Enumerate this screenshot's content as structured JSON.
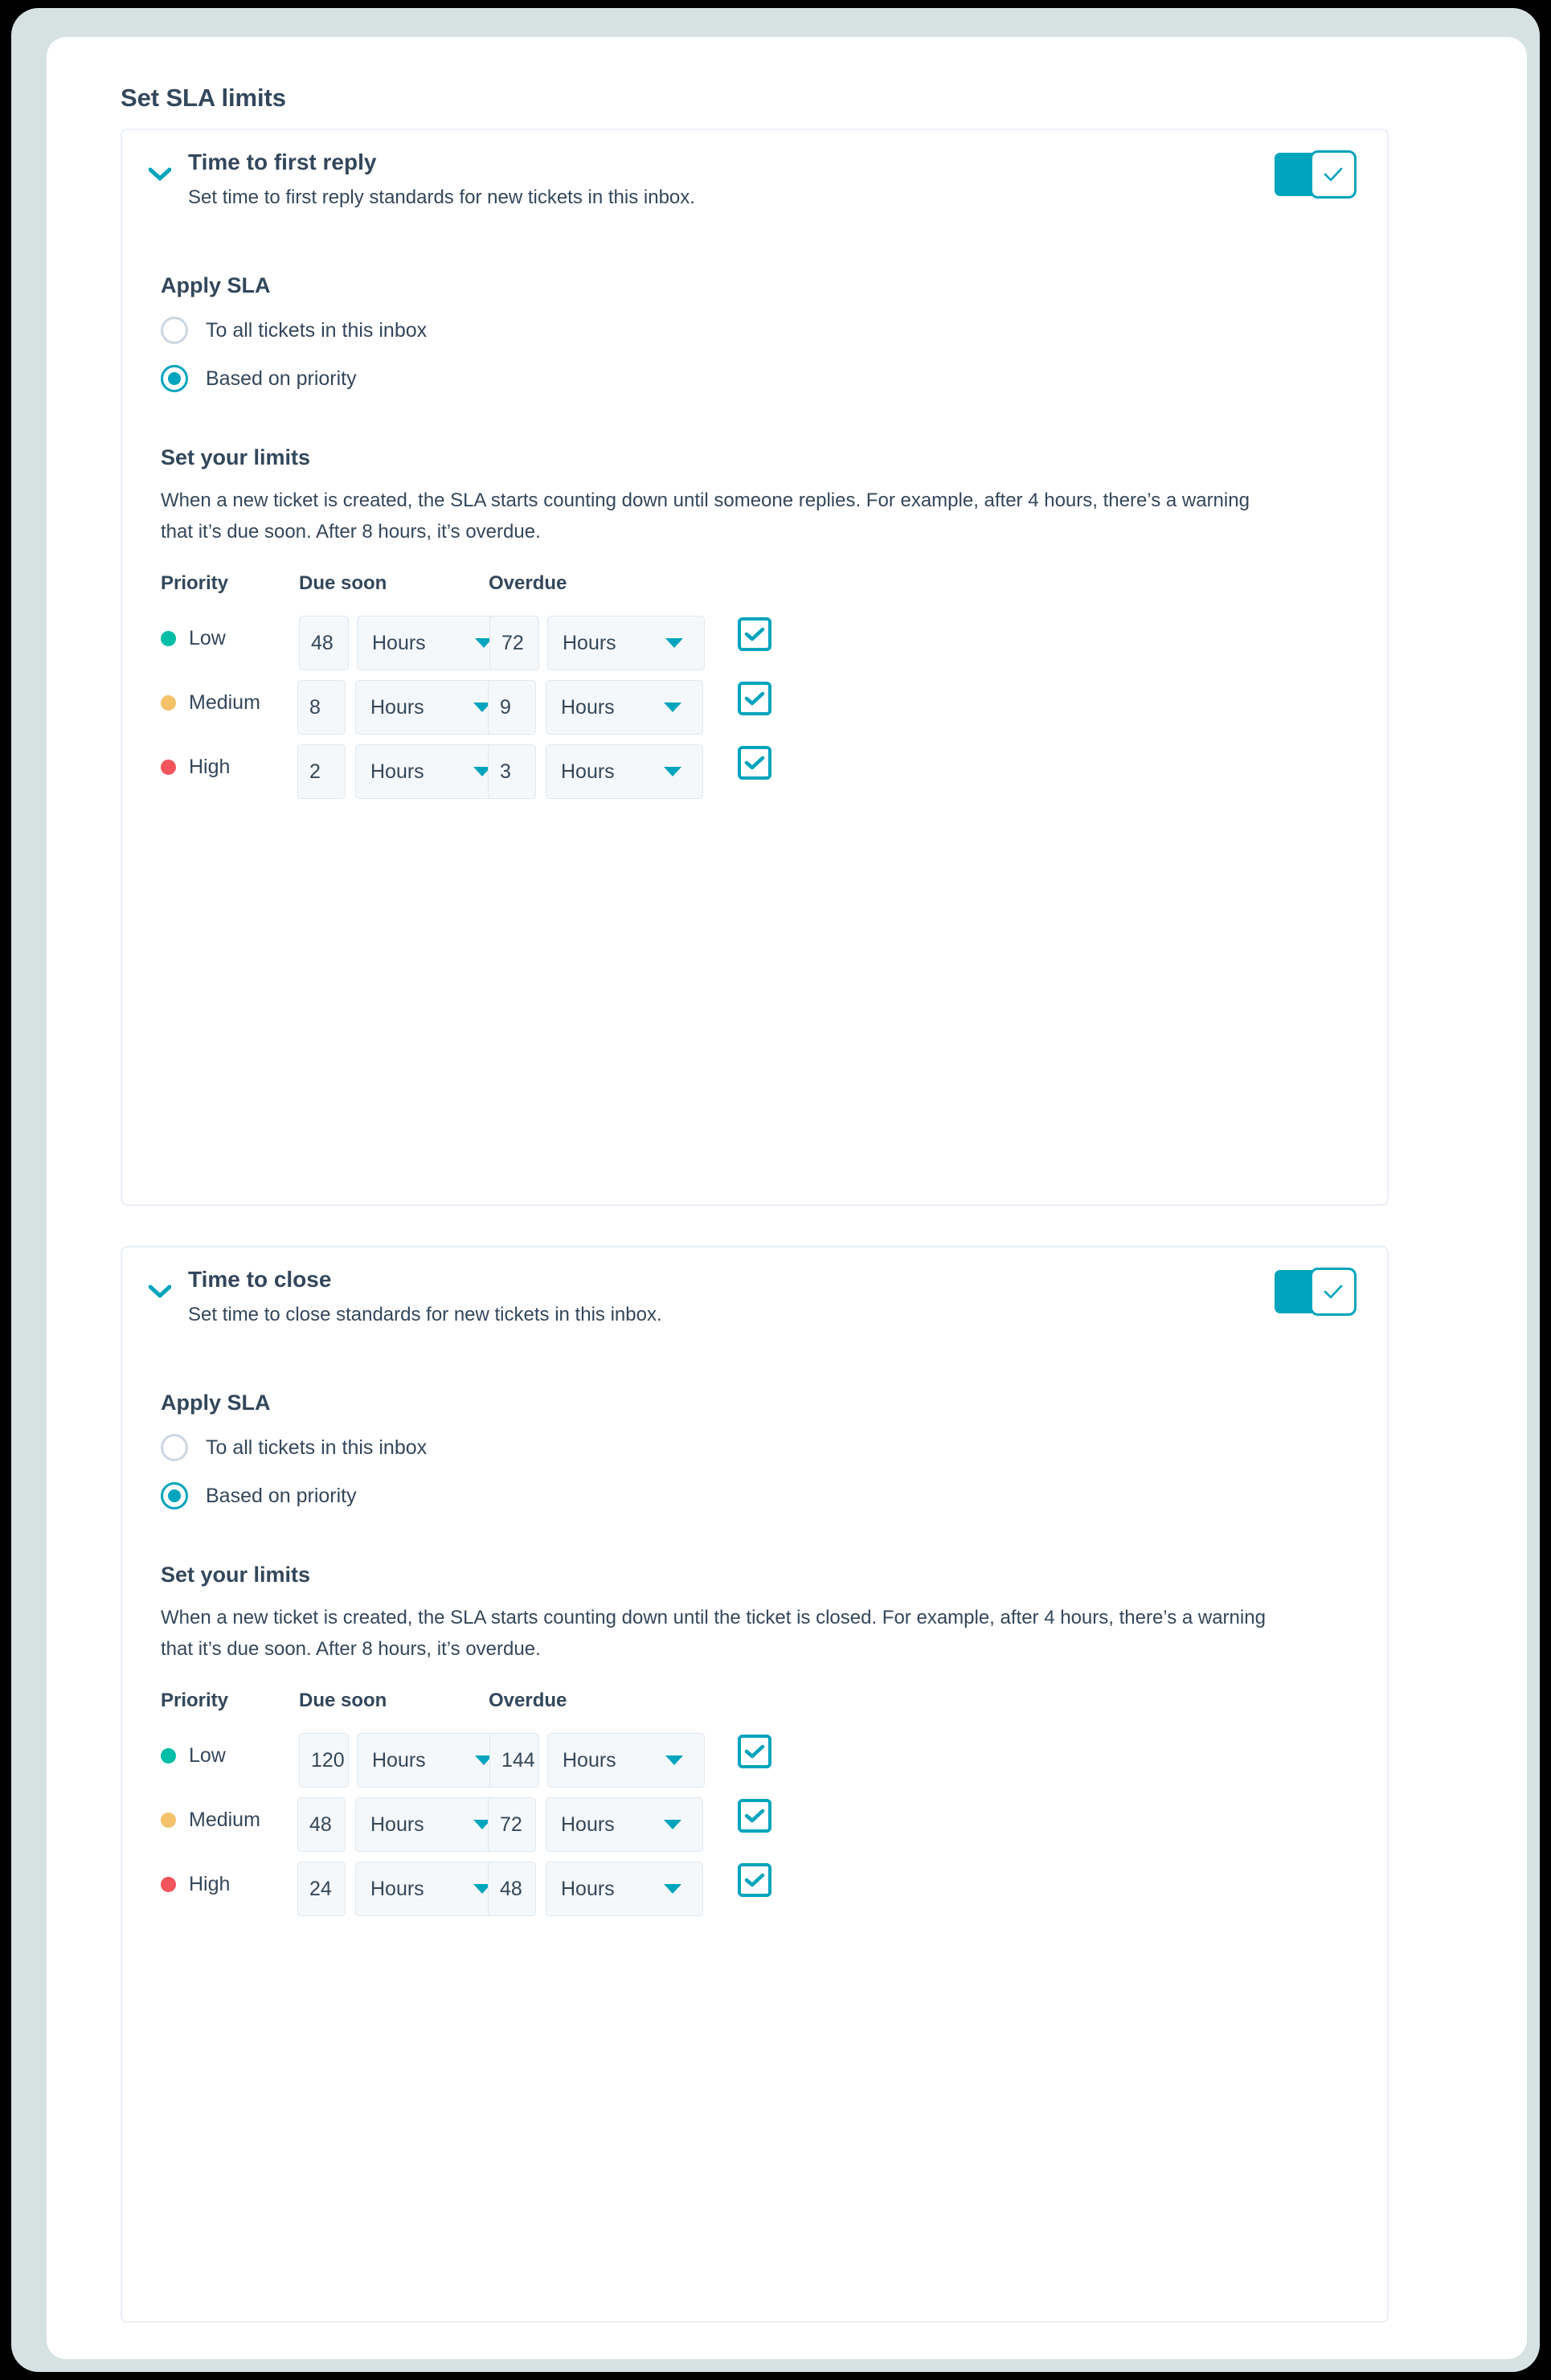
{
  "page": {
    "title": "Set SLA limits"
  },
  "colors": {
    "accent": "#00A4BD",
    "text": "#33475B",
    "low": "#00BDA5",
    "medium": "#F5C26B",
    "high": "#F2545B",
    "input_bg": "#F5F8FA",
    "card_border": "#EAF0F6"
  },
  "sections": [
    {
      "id": "time-to-first-reply",
      "title": "Time to first reply",
      "subtitle": "Set time to first reply standards for new tickets in this inbox.",
      "toggle_on": true,
      "collapse_icon": "chevron-down-icon",
      "apply_sla": {
        "heading": "Apply SLA",
        "options": [
          {
            "label": "To all tickets in this inbox",
            "selected": false
          },
          {
            "label": "Based on priority",
            "selected": true
          }
        ]
      },
      "limits": {
        "heading": "Set your limits",
        "description": "When a new ticket is created, the SLA starts counting down until someone replies. For example, after 4 hours, there’s a warning that it’s due soon. After 8 hours, it’s overdue.",
        "columns": [
          "Priority",
          "Due soon",
          "Overdue"
        ],
        "rows": [
          {
            "priority": "Low",
            "dot": "#00BDA5",
            "due_value": "48",
            "due_unit": "Hours",
            "over_value": "72",
            "over_unit": "Hours",
            "enabled": true
          },
          {
            "priority": "Medium",
            "dot": "#F5C26B",
            "due_value": "8",
            "due_unit": "Hours",
            "over_value": "9",
            "over_unit": "Hours",
            "enabled": true
          },
          {
            "priority": "High",
            "dot": "#F2545B",
            "due_value": "2",
            "due_unit": "Hours",
            "over_value": "3",
            "over_unit": "Hours",
            "enabled": true
          }
        ]
      }
    },
    {
      "id": "time-to-close",
      "title": "Time to close",
      "subtitle": "Set time to close standards for new tickets in this inbox.",
      "toggle_on": true,
      "collapse_icon": "chevron-down-icon",
      "apply_sla": {
        "heading": "Apply SLA",
        "options": [
          {
            "label": "To all tickets in this inbox",
            "selected": false
          },
          {
            "label": "Based on priority",
            "selected": true
          }
        ]
      },
      "limits": {
        "heading": "Set your limits",
        "description": "When a new ticket is created, the SLA starts counting down until the ticket is closed. For example, after 4 hours, there’s a warning that it’s due soon. After 8 hours, it’s overdue.",
        "columns": [
          "Priority",
          "Due soon",
          "Overdue"
        ],
        "rows": [
          {
            "priority": "Low",
            "dot": "#00BDA5",
            "due_value": "120",
            "due_unit": "Hours",
            "over_value": "144",
            "over_unit": "Hours",
            "enabled": true
          },
          {
            "priority": "Medium",
            "dot": "#F5C26B",
            "due_value": "48",
            "due_unit": "Hours",
            "over_value": "72",
            "over_unit": "Hours",
            "enabled": true
          },
          {
            "priority": "High",
            "dot": "#F2545B",
            "due_value": "24",
            "due_unit": "Hours",
            "over_value": "48",
            "over_unit": "Hours",
            "enabled": true
          }
        ]
      }
    }
  ]
}
